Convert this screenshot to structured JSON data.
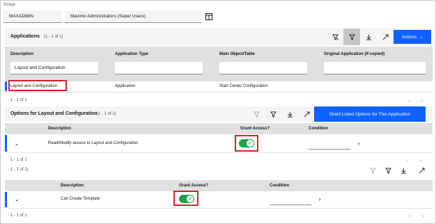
{
  "group": {
    "label": "Group",
    "id_value": "MAXADMIN",
    "description_value": "Maximo Administrators (Super Users)"
  },
  "applications": {
    "title": "Applications",
    "count": "(1 - 1 of 1)",
    "actions_label": "Actions",
    "columns": [
      "Description",
      "Application Type",
      "Main Object/Table",
      "Original Application (If copied)"
    ],
    "filter_description": "Layout and Configuration",
    "row": {
      "description": "Layout and Configuration",
      "type": "Application",
      "object": "Start Center Configuration"
    },
    "pagination": "1 - 1 of 1"
  },
  "options": {
    "title": "Options for Layout and Configuration",
    "count": "(1 - 1 of 1)",
    "grant_button": "Grant Listed Options for This Application",
    "columns": [
      "Description",
      "Grant Access?",
      "Condition"
    ],
    "row": {
      "description": "Read/Modify access to Layout and Configuration"
    },
    "pagination": "1 - 1 of 1"
  },
  "sub_options": {
    "count": "1 - 1 of 1)",
    "columns": [
      "Description",
      "Grant Access?",
      "Condition"
    ],
    "row": {
      "description": "Can Create Template"
    },
    "pagination": "1 - 1 of 1"
  },
  "colors": {
    "accent": "#0f62fe",
    "toggle_on": "#24a148",
    "highlight": "#da1e28"
  },
  "icons": [
    "table-icon",
    "clear-filter-icon",
    "filter-icon",
    "download-icon",
    "collapse-icon",
    "chevron-down-icon",
    "chevron-right-icon",
    "chevron-left-icon",
    "checkmark-icon"
  ]
}
